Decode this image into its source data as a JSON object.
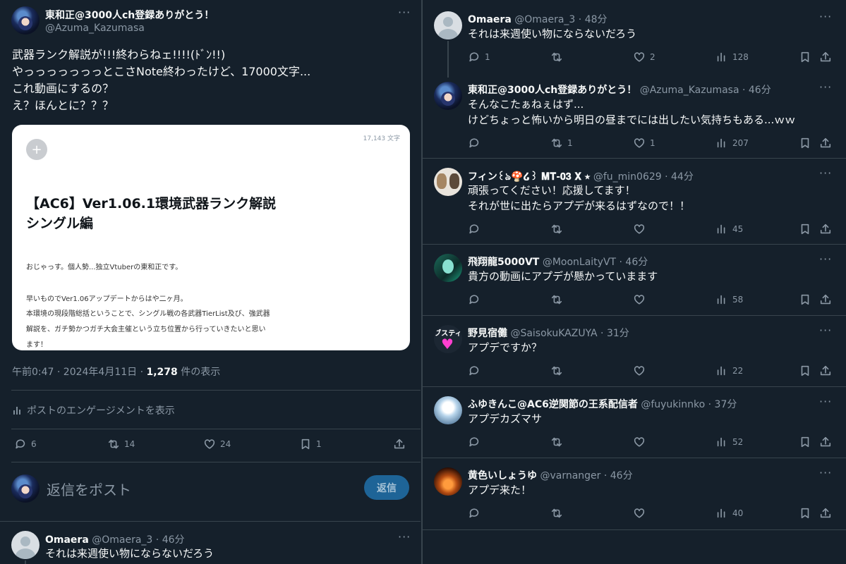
{
  "main_post": {
    "name": "東和正@3000人ch登録ありがとう！",
    "handle": "@Azuma_Kazumasa",
    "lines": [
      "武器ランク解説が!!!終わらねェ!!!!(ﾄﾞﾝ!!)",
      "やっっっっっっっとこさNote終わったけど、17000文字...",
      "これ動画にするの？",
      "え？ほんとに？？？"
    ],
    "card": {
      "char_count": "17,143 文字",
      "title_line1": "【AC6】Ver1.06.1環境武器ランク解説",
      "title_line2": "シングル編",
      "body_lines": [
        "おじゃっす。個人勢...独立Vtuberの東和正です。",
        "早いものでVer1.06アップデートからはや二ヶ月。",
        "本環境の現段階総括ということで、シングル戦の各武器TierList及び、強武器",
        "解説を、ガチ勢かつガチ大会主催という立ち位置から行っていきたいと思い",
        "ます！"
      ]
    },
    "timestamp": "午前0:47 · 2024年4月11日 · ",
    "views_count": "1,278",
    "views_label": " 件の表示",
    "engagement_link": "ポストのエンゲージメントを表示",
    "stats": {
      "replies": "6",
      "reposts": "14",
      "likes": "24",
      "bookmarks": "1"
    }
  },
  "reply_box": {
    "placeholder": "返信をポスト",
    "button": "返信"
  },
  "left_reply": {
    "name": "Omaera",
    "handle_time": "@Omaera_3 · 46分",
    "text": "それは来週使い物にならないだろう"
  },
  "replies": [
    {
      "name": "Omaera",
      "meta": "@Omaera_3 · 48分",
      "lines": [
        "それは来週使い物にならないだろう"
      ],
      "reply": "1",
      "repost": "",
      "like": "2",
      "views": "128"
    },
    {
      "name": "東和正@3000人ch登録ありがとう！",
      "meta": "@Azuma_Kazumasa · 46分",
      "lines": [
        "そんなこたぁねぇはず...",
        "けどちょっと怖いから明日の昼までには出したい気持ちもある...ｗｗ"
      ],
      "reply": "",
      "repost": "1",
      "like": "1",
      "views": "207"
    },
    {
      "name": "フィン꒰ঌ🍄໒꒱ 𝐌𝐓-𝟎𝟑 𝐗 ⭑",
      "meta": "@fu_min0629 · 44分",
      "lines": [
        "頑張ってください！応援してます！",
        "それが世に出たらアプデが来るはずなので！！"
      ],
      "reply": "",
      "repost": "",
      "like": "",
      "views": "45"
    },
    {
      "name": "飛翔龍5000VT",
      "meta": "@MoonLaityVT · 46分",
      "lines": [
        "貴方の動画にアプデが懸かっていまます"
      ],
      "reply": "",
      "repost": "",
      "like": "",
      "views": "58"
    },
    {
      "name": "野見宿儺",
      "meta": "@SaisokuKAZUYA · 31分",
      "lines": [
        "アプデですか？"
      ],
      "reply": "",
      "repost": "",
      "like": "",
      "views": "22"
    },
    {
      "name": "ふゆきんこ@AC6逆関節の王系配信者",
      "meta": "@fuyukinnko · 37分",
      "lines": [
        "アプデカズマサ"
      ],
      "reply": "",
      "repost": "",
      "like": "",
      "views": "52"
    },
    {
      "name": "黄色いしょうゆ",
      "meta": "@varnanger · 46分",
      "lines": [
        "アプデ来た！"
      ],
      "reply": "",
      "repost": "",
      "like": "",
      "views": "40"
    }
  ],
  "saisoku_avatar_text": "ブスティ",
  "colors": {
    "background": "#15202b",
    "border": "#38444d",
    "muted": "#8b98a5",
    "accent": "#1d9bf0",
    "heart_pink": "#ff3fd0"
  },
  "icons": [
    "more-icon",
    "reply-icon",
    "repost-icon",
    "like-icon",
    "views-icon",
    "bookmark-icon",
    "share-icon",
    "stats-icon",
    "add-image-icon"
  ]
}
